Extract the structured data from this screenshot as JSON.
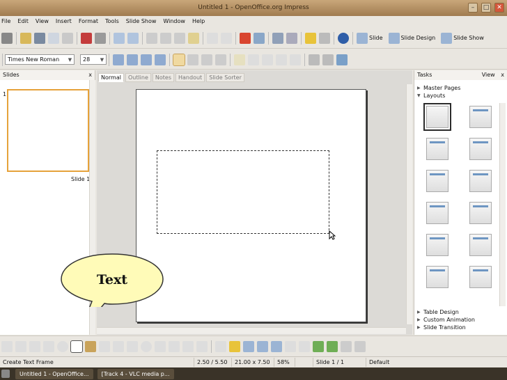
{
  "window": {
    "title": "Untitled 1 - OpenOffice.org Impress"
  },
  "menu": [
    "File",
    "Edit",
    "View",
    "Insert",
    "Format",
    "Tools",
    "Slide Show",
    "Window",
    "Help"
  ],
  "toolbar1": {
    "slide_label": "Slide",
    "slide_design_label": "Slide Design",
    "slide_show_label": "Slide Show"
  },
  "formatting": {
    "font_name": "Times New Roman",
    "font_size": "28"
  },
  "slides_panel": {
    "title": "Slides",
    "close": "x",
    "slide_number": "1",
    "slide_caption": "Slide 1"
  },
  "view_tabs": [
    "Normal",
    "Outline",
    "Notes",
    "Handout",
    "Slide Sorter"
  ],
  "tasks_panel": {
    "title": "Tasks",
    "view_label": "View",
    "close": "x",
    "sections_top": [
      "Master Pages",
      "Layouts"
    ],
    "sections_bottom": [
      "Table Design",
      "Custom Animation",
      "Slide Transition"
    ]
  },
  "callout": {
    "text": "Text"
  },
  "status": {
    "message": "Create Text Frame",
    "position": "2.50 / 5.50",
    "size": "21.00 x 7.50",
    "zoom": "58%",
    "slide": "Slide 1 / 1",
    "layout": "Default"
  },
  "taskbar": {
    "item1": "Untitled 1 - OpenOffice...",
    "item2": "[Track 4 - VLC media p..."
  },
  "colors": {
    "titlebar": "#b08a5d",
    "selection": "#e6a23a",
    "layout_accent": "#6e96c2"
  }
}
